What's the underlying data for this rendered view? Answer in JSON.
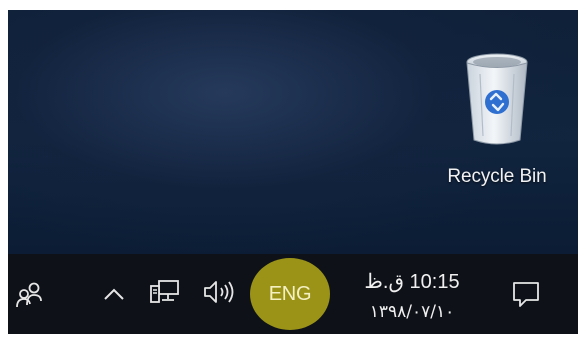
{
  "desktop": {
    "icons": [
      {
        "label": "Recycle Bin",
        "icon": "recycle-bin-icon"
      }
    ]
  },
  "taskbar": {
    "people_icon": "people-icon",
    "overflow_icon": "chevron-up-icon",
    "network_icon": "network-icon",
    "volume_icon": "speaker-volume-icon",
    "language": "ENG",
    "clock": {
      "time": "10:15 ق.ظ",
      "date": "۱۳۹۸/۰۷/۱۰"
    },
    "action_center_icon": "notification-icon"
  },
  "colors": {
    "taskbar_bg": "#0e1218",
    "highlight": "#9a9318",
    "desktop_bg": "#11253f"
  }
}
